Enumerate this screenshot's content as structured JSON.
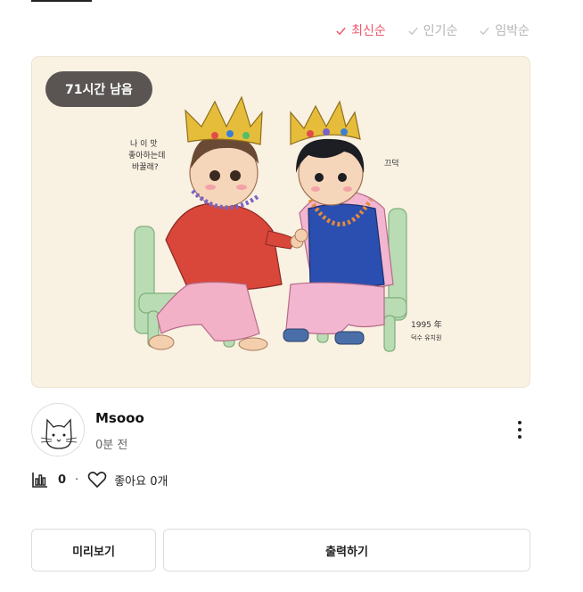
{
  "sort_tabs": [
    {
      "label": "최신순",
      "active": true
    },
    {
      "label": "인기순",
      "active": false
    },
    {
      "label": "임박순",
      "active": false
    }
  ],
  "card": {
    "badge": "71시간 남음",
    "illustration_text": {
      "speech_line1": "나 이 맛",
      "speech_line2": "좋아하는데",
      "speech_line3": "바꿀래?",
      "nod": "끄덕",
      "year": "1995 年",
      "signature": "덕수 유치원"
    }
  },
  "author": {
    "name": "Msooo",
    "time": "0분 전"
  },
  "stats": {
    "views": "0",
    "separator": "·",
    "likes_label": "좋아요 0개"
  },
  "buttons": {
    "preview": "미리보기",
    "print": "출력하기"
  },
  "colors": {
    "accent": "#f0556a",
    "inactive": "#b5b5b5",
    "badge_bg": "#5a5553",
    "card_bg": "#f9f1e2"
  }
}
